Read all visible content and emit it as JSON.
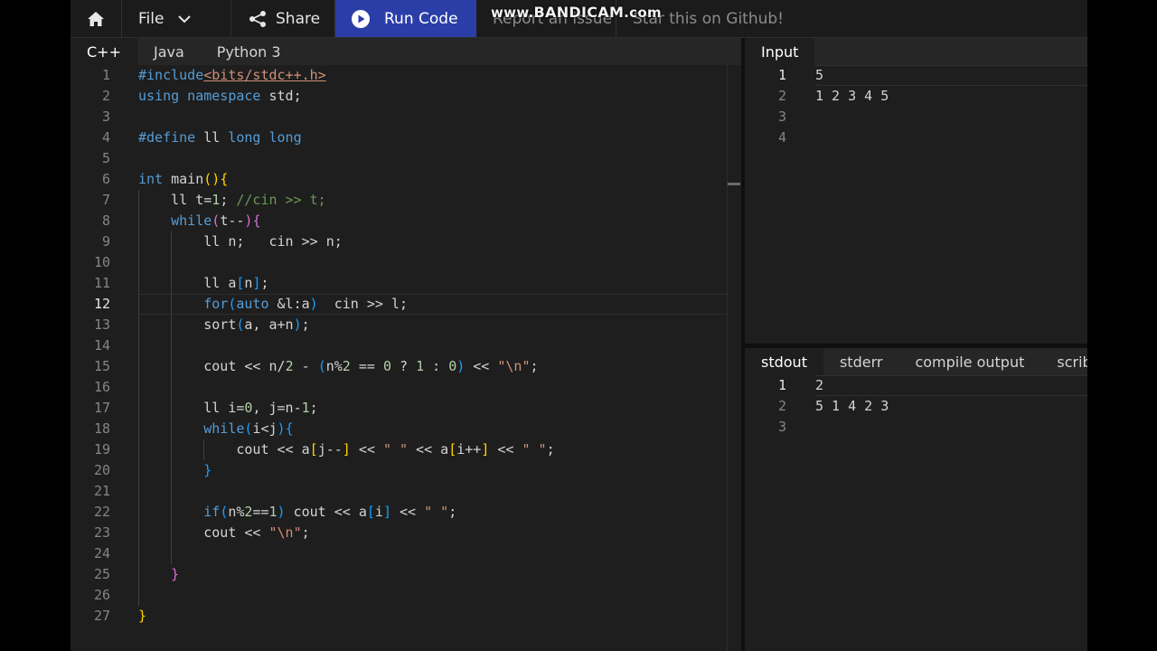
{
  "watermark": {
    "prefix": "www.",
    "brand": "BANDICAM",
    "suffix": ".com"
  },
  "menubar": {
    "home_icon": "home-icon",
    "file_label": "File",
    "share_label": "Share",
    "run_label": "Run Code",
    "report_label": "Report an issue",
    "star_label": "Star this on Github!"
  },
  "editor": {
    "tabs": [
      "C++",
      "Java",
      "Python 3"
    ],
    "active_tab": "C++",
    "current_line": 12
  },
  "input_panel": {
    "tab": "Input",
    "lines": [
      "5",
      "1 2 3 4 5",
      "",
      ""
    ]
  },
  "output_panel": {
    "tabs": [
      "stdout",
      "stderr",
      "compile output",
      "scrib"
    ],
    "active_tab": "stdout",
    "lines": [
      "2",
      "5 1 4 2 3",
      ""
    ]
  },
  "colors": {
    "accent": "#2b3ea8",
    "keyword": "#569cd6",
    "string": "#ce9178",
    "comment": "#6a9955",
    "number": "#b5cea8",
    "bracket_gold": "#ffd700",
    "bracket_orchid": "#da70d6",
    "bracket_blue": "#179fff"
  },
  "code_lines": [
    [
      [
        "#include",
        "pp"
      ],
      [
        "<bits/stdc++.h>",
        "inc"
      ]
    ],
    [
      [
        "using namespace",
        "kw"
      ],
      [
        " std;",
        ""
      ]
    ],
    [],
    [
      [
        "#define",
        "pp"
      ],
      [
        " ll ",
        ""
      ],
      [
        "long long",
        "kw"
      ]
    ],
    [],
    [
      [
        "int",
        "kw"
      ],
      [
        " main",
        ""
      ],
      [
        "()",
        "b1"
      ],
      [
        "{",
        "b1"
      ]
    ],
    [
      [
        "    ll t=",
        ""
      ],
      [
        "1",
        "nm"
      ],
      [
        "; ",
        ""
      ],
      [
        "//cin >> t;",
        "cm"
      ]
    ],
    [
      [
        "    ",
        ""
      ],
      [
        "while",
        "kw"
      ],
      [
        "(",
        "b2"
      ],
      [
        "t--",
        ""
      ],
      [
        ")",
        "b2"
      ],
      [
        "{",
        "b2"
      ]
    ],
    [
      [
        "        ll n;   cin >> n;",
        ""
      ]
    ],
    [],
    [
      [
        "        ll a",
        ""
      ],
      [
        "[",
        "b3"
      ],
      [
        "n",
        ""
      ],
      [
        "]",
        "b3"
      ],
      [
        ";",
        ""
      ]
    ],
    [
      [
        "        ",
        ""
      ],
      [
        "for",
        "kw"
      ],
      [
        "(",
        "b3"
      ],
      [
        "auto",
        "kw"
      ],
      [
        " &l:a",
        ""
      ],
      [
        ")",
        "b3"
      ],
      [
        "  cin >> l;",
        ""
      ]
    ],
    [
      [
        "        sort",
        ""
      ],
      [
        "(",
        "b3"
      ],
      [
        "a, a+n",
        ""
      ],
      [
        ")",
        "b3"
      ],
      [
        ";",
        ""
      ]
    ],
    [],
    [
      [
        "        cout << n/",
        ""
      ],
      [
        "2",
        "nm"
      ],
      [
        " - ",
        ""
      ],
      [
        "(",
        "b3"
      ],
      [
        "n%",
        ""
      ],
      [
        "2",
        "nm"
      ],
      [
        " == ",
        ""
      ],
      [
        "0",
        "nm"
      ],
      [
        " ? ",
        ""
      ],
      [
        "1",
        "nm"
      ],
      [
        " : ",
        ""
      ],
      [
        "0",
        "nm"
      ],
      [
        ")",
        "b3"
      ],
      [
        " << ",
        ""
      ],
      [
        "\"\\n\"",
        "st"
      ],
      [
        ";",
        ""
      ]
    ],
    [],
    [
      [
        "        ll i=",
        ""
      ],
      [
        "0",
        "nm"
      ],
      [
        ", j=n-",
        ""
      ],
      [
        "1",
        "nm"
      ],
      [
        ";",
        ""
      ]
    ],
    [
      [
        "        ",
        ""
      ],
      [
        "while",
        "kw"
      ],
      [
        "(",
        "b3"
      ],
      [
        "i<j",
        ""
      ],
      [
        ")",
        "b3"
      ],
      [
        "{",
        "b3"
      ]
    ],
    [
      [
        "            cout << a",
        ""
      ],
      [
        "[",
        "b1"
      ],
      [
        "j--",
        ""
      ],
      [
        "]",
        "b1"
      ],
      [
        " << ",
        ""
      ],
      [
        "\" \"",
        "st"
      ],
      [
        " << a",
        ""
      ],
      [
        "[",
        "b1"
      ],
      [
        "i++",
        ""
      ],
      [
        "]",
        "b1"
      ],
      [
        " << ",
        ""
      ],
      [
        "\" \"",
        "st"
      ],
      [
        ";",
        ""
      ]
    ],
    [
      [
        "        ",
        ""
      ],
      [
        "}",
        "b3"
      ]
    ],
    [],
    [
      [
        "        ",
        ""
      ],
      [
        "if",
        "kw"
      ],
      [
        "(",
        "b3"
      ],
      [
        "n%",
        ""
      ],
      [
        "2",
        "nm"
      ],
      [
        "==",
        ""
      ],
      [
        "1",
        "nm"
      ],
      [
        ")",
        "b3"
      ],
      [
        " cout << a",
        ""
      ],
      [
        "[",
        "b3"
      ],
      [
        "i",
        ""
      ],
      [
        "]",
        "b3"
      ],
      [
        " << ",
        ""
      ],
      [
        "\" \"",
        "st"
      ],
      [
        ";",
        ""
      ]
    ],
    [
      [
        "        cout << ",
        ""
      ],
      [
        "\"\\n\"",
        "st"
      ],
      [
        ";",
        ""
      ]
    ],
    [],
    [
      [
        "    ",
        ""
      ],
      [
        "}",
        "b2"
      ]
    ],
    [],
    [
      [
        "}",
        "b1"
      ]
    ]
  ]
}
